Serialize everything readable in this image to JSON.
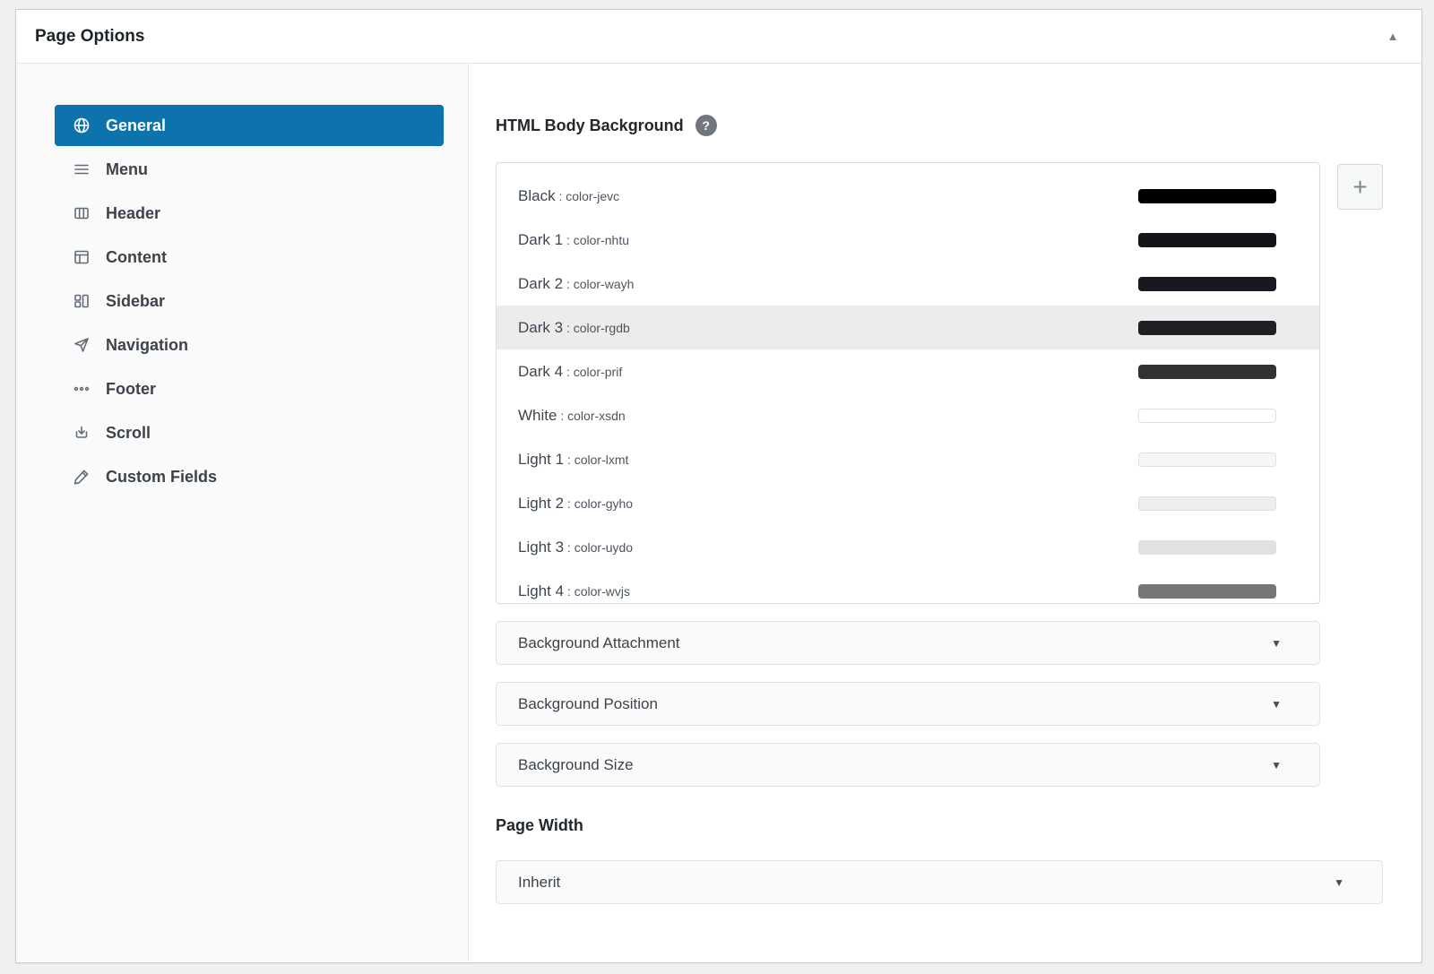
{
  "colors": {
    "accent": "#0d73ad",
    "selected_row_bg": "#ececec",
    "help_badge_bg": "#72777d",
    "sidebar_bg": "#fafafa",
    "page_bg": "#f0f0f1"
  },
  "panel": {
    "title": "Page Options",
    "collapse_icon": "▲"
  },
  "sidebar": {
    "items": [
      {
        "label": "General",
        "icon": "globe-icon",
        "active": true
      },
      {
        "label": "Menu",
        "icon": "menu-icon"
      },
      {
        "label": "Header",
        "icon": "columns-icon"
      },
      {
        "label": "Content",
        "icon": "layout-icon"
      },
      {
        "label": "Sidebar",
        "icon": "grid-icon"
      },
      {
        "label": "Navigation",
        "icon": "paper-plane-icon"
      },
      {
        "label": "Footer",
        "icon": "ellipsis-icon"
      },
      {
        "label": "Scroll",
        "icon": "download-icon"
      },
      {
        "label": "Custom Fields",
        "icon": "pencil-icon"
      }
    ]
  },
  "main": {
    "background_field": {
      "label": "HTML Body Background",
      "help_icon": "?",
      "separator": " : ",
      "add_button_label": "+",
      "colors": [
        {
          "name": "Black",
          "slug": "color-jevc",
          "hex": "#000000"
        },
        {
          "name": "Dark 1",
          "slug": "color-nhtu",
          "hex": "#131519"
        },
        {
          "name": "Dark 2",
          "slug": "color-wayh",
          "hex": "#17191e"
        },
        {
          "name": "Dark 3",
          "slug": "color-rgdb",
          "hex": "#1e2024",
          "selected": true
        },
        {
          "name": "Dark 4",
          "slug": "color-prif",
          "hex": "#303236"
        },
        {
          "name": "White",
          "slug": "color-xsdn",
          "hex": "#ffffff",
          "bordered": true
        },
        {
          "name": "Light 1",
          "slug": "color-lxmt",
          "hex": "#f6f6f8",
          "bordered": true
        },
        {
          "name": "Light 2",
          "slug": "color-gyho",
          "hex": "#ededef",
          "bordered": true
        },
        {
          "name": "Light 3",
          "slug": "color-uydo",
          "hex": "#e1e1e3",
          "bordered": true
        },
        {
          "name": "Light 4",
          "slug": "color-wvjs",
          "hex": "#767679"
        }
      ]
    },
    "dropdowns": [
      {
        "label": "Background Attachment"
      },
      {
        "label": "Background Position"
      },
      {
        "label": "Background Size"
      }
    ],
    "page_width": {
      "label": "Page Width",
      "value": "Inherit"
    },
    "caret_icon": "▼"
  }
}
